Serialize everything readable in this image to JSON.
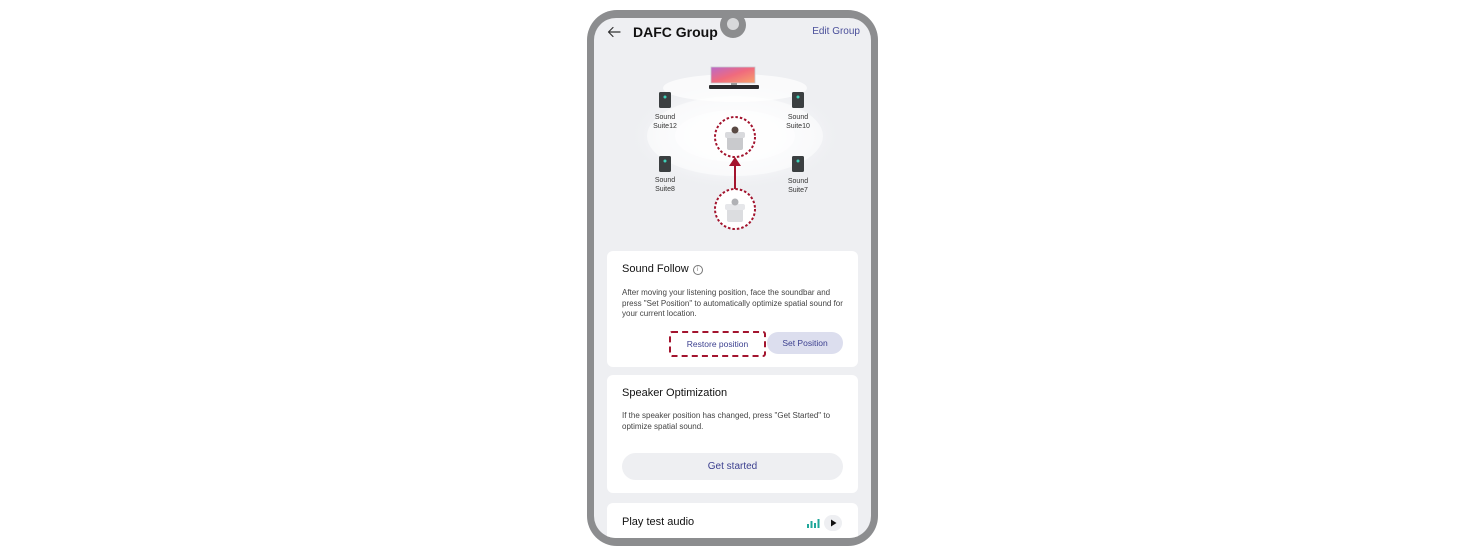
{
  "header": {
    "title": "DAFC Group",
    "edit_label": "Edit Group"
  },
  "layout_stage": {
    "speakers": [
      {
        "line1": "Sound",
        "line2": "Suite12"
      },
      {
        "line1": "Sound",
        "line2": "Suite10"
      },
      {
        "line1": "Sound",
        "line2": "Suite8"
      },
      {
        "line1": "Sound",
        "line2": "Suite7"
      }
    ]
  },
  "sound_follow": {
    "title": "Sound Follow",
    "description": "After moving your listening position, face the soundbar and press \"Set Position\" to automatically optimize spatial sound for your current location.",
    "restore_label": "Restore position",
    "set_label": "Set Position"
  },
  "speaker_optimization": {
    "title": "Speaker Optimization",
    "description": "If the speaker position has changed, press \"Get Started\" to optimize spatial sound.",
    "button_label": "Get started"
  },
  "test_audio": {
    "title": "Play test audio"
  },
  "colors": {
    "accent": "#3d4190",
    "highlight_dashed": "#a3142e",
    "equalizer": "#1fa79a"
  }
}
